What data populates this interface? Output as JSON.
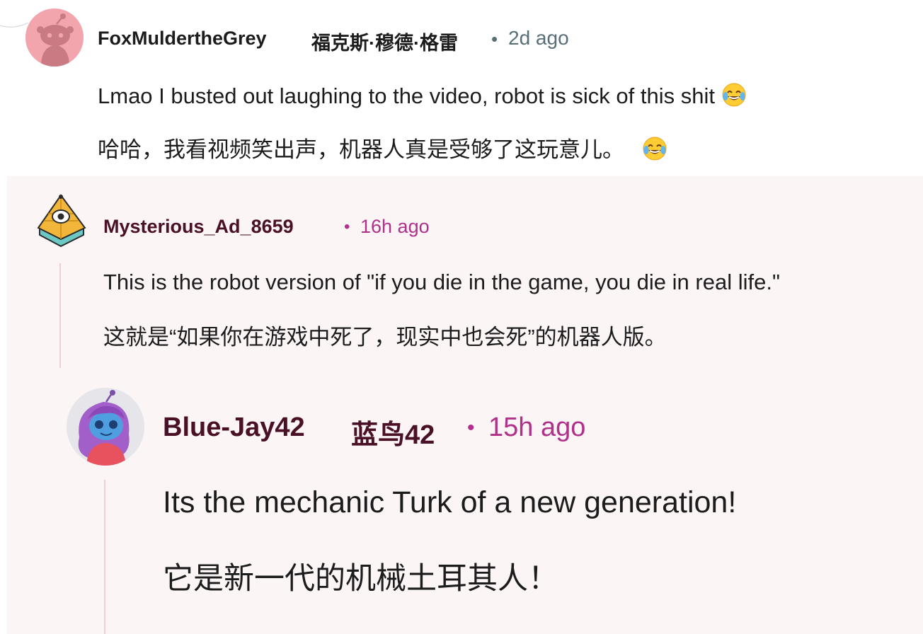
{
  "comments": [
    {
      "username": "FoxMuldertheGrey",
      "username_translation": "福克斯·穆德·格雷",
      "separator": "•",
      "timestamp": "2d ago",
      "text_en": "Lmao I busted out laughing to the video, robot is sick of this shit",
      "text_zh": "哈哈，我看视频笑出声，机器人真是受够了这玩意儿。",
      "emoji": "face-with-tears-of-joy"
    },
    {
      "username": "Mysterious_Ad_8659",
      "separator": "•",
      "timestamp": "16h ago",
      "text_en": "This is the robot version of \"if you die in the game, you die in real life.\"",
      "text_zh": "这就是“如果你在游戏中死了，现实中也会死”的机器人版。"
    },
    {
      "username": "Blue-Jay42",
      "username_translation": "蓝鸟42",
      "separator": "•",
      "timestamp": "15h ago",
      "text_en": "Its the mechanic Turk of a new generation!",
      "text_zh": "它是新一代的机械土耳其人！"
    }
  ],
  "colors": {
    "username_dark": "#1c1c1c",
    "username_reply": "#4a1026",
    "timestamp_top": "#576f76",
    "timestamp_reply": "#b0308a",
    "thread_line": "#f4cdd2",
    "reply_background": "#fbf5f6",
    "avatar_top": "#f3a5ad"
  }
}
